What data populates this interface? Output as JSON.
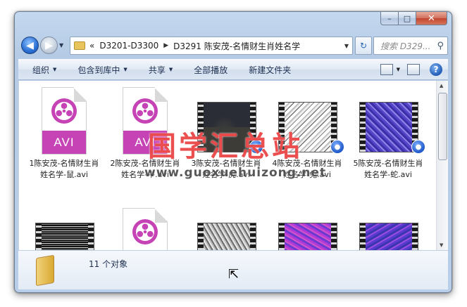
{
  "window": {
    "caption_buttons": {
      "minimize": "–",
      "maximize": "□",
      "close": "✕"
    }
  },
  "navbar": {
    "back_icon": "◀",
    "forward_icon": "▶",
    "crumbs": [
      "D3201-D3300",
      "D3291 陈安茂-名情财生肖姓名学"
    ],
    "crumb_lead": "«",
    "crumb_sep": "▶",
    "dropdown_icon": "▼",
    "refresh_icon": "↻",
    "search_placeholder": "搜索 D329...",
    "search_icon": "⚲"
  },
  "toolbar": {
    "organize": "组织",
    "include_library": "包含到库中",
    "share": "共享",
    "play_all": "全部播放",
    "new_folder": "新建文件夹",
    "help": "?"
  },
  "files": [
    {
      "label": "1陈安茂-名情财生肖姓名学-鼠.avi",
      "kind": "avi"
    },
    {
      "label": "2陈安茂-名情财生肖姓名学-牛.avi",
      "kind": "avi"
    },
    {
      "label": "3陈安茂-名情财生肖姓名学-虎.avi",
      "kind": "video"
    },
    {
      "label": "4陈安茂-名情财生肖姓名学-兔.avi",
      "kind": "video"
    },
    {
      "label": "5陈安茂-名情财生肖姓名学-蛇.avi",
      "kind": "video"
    },
    {
      "label": "",
      "kind": "video"
    },
    {
      "label": "",
      "kind": "avi"
    },
    {
      "label": "",
      "kind": "video"
    },
    {
      "label": "",
      "kind": "video"
    },
    {
      "label": "",
      "kind": "video"
    }
  ],
  "avi_badge": "AVI",
  "watermark": {
    "title": "国学汇总站",
    "url": "www.guoxuehuizong.net"
  },
  "details": {
    "count": "11 个对象"
  },
  "colors": {
    "avi_accent": "#c543b5",
    "window_frame": "#b9cee8",
    "watermark": "#e62828"
  }
}
